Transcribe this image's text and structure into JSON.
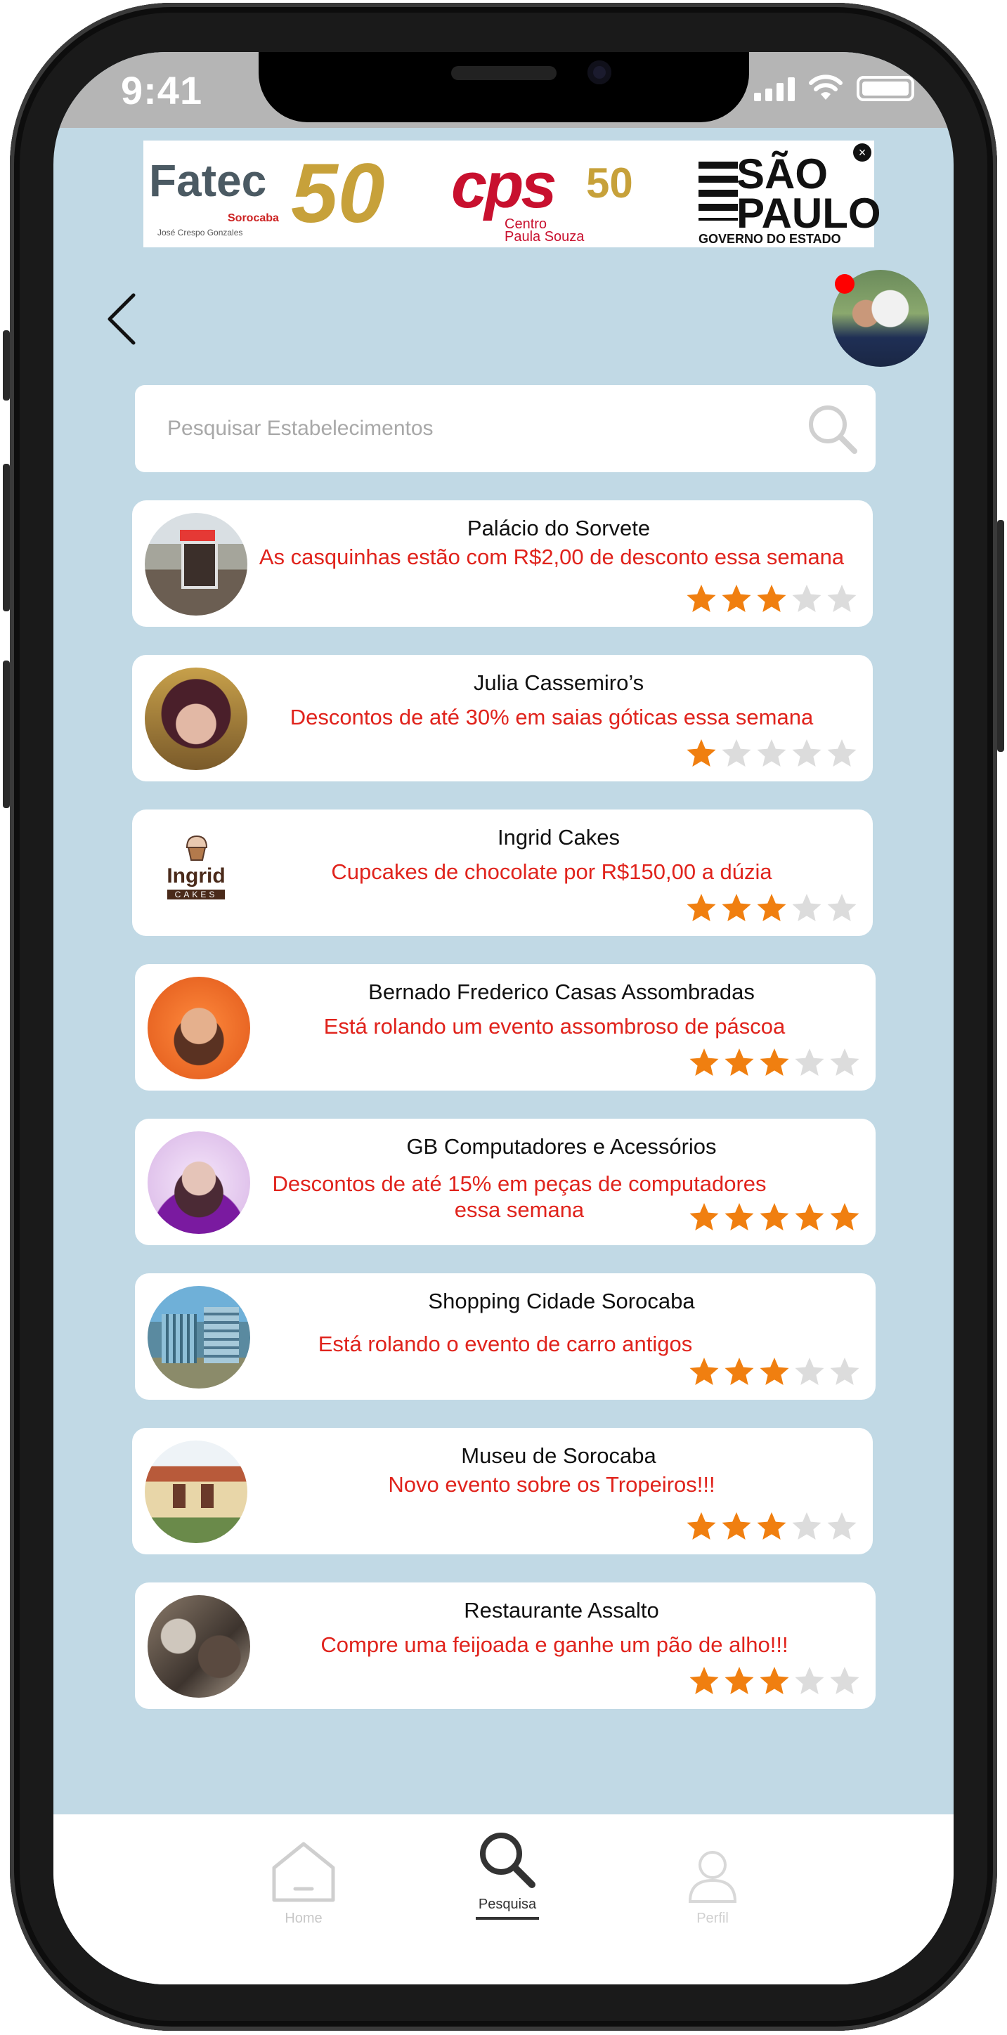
{
  "status_bar": {
    "time": "9:41"
  },
  "banner": {
    "fatec_text": "Fatec",
    "fatec_sub": "Sorocaba",
    "fatec_sub2": "José Crespo Gonzales",
    "fatec_50": "50",
    "cps_text": "cps",
    "cps_50": "50",
    "cps_sub": "Centro\nPaula Souza",
    "sp_text": "SÃO\nPAULO",
    "sp_sub": "GOVERNO DO ESTADO",
    "close": "×"
  },
  "search": {
    "placeholder": "Pesquisar Estabelecimentos"
  },
  "establishments": [
    {
      "name": "Palácio do Sorvete",
      "promo": "As casquinhas estão com R$2,00 de desconto essa semana",
      "rating": 3
    },
    {
      "name": "Julia Cassemiro’s",
      "promo": "Descontos de até 30% em saias góticas essa semana",
      "rating": 1
    },
    {
      "name": "Ingrid Cakes",
      "promo": "Cupcakes de chocolate por R$150,00 a dúzia",
      "rating": 3,
      "logo_text": "Ingrid",
      "logo_sub": "CAKES"
    },
    {
      "name": "Bernado Frederico Casas Assombradas",
      "promo": "Está rolando um evento assombroso de páscoa",
      "rating": 3
    },
    {
      "name": "GB Computadores e Acessórios",
      "promo": "Descontos de até 15% em peças de computadores essa semana",
      "rating": 5
    },
    {
      "name": "Shopping Cidade Sorocaba",
      "promo": "Está rolando o evento de carro antigos",
      "rating": 3
    },
    {
      "name": "Museu de Sorocaba",
      "promo": "Novo evento sobre os Tropeiros!!!",
      "rating": 3
    },
    {
      "name": "Restaurante Assalto",
      "promo": "Compre uma feijoada e ganhe um pão de alho!!!",
      "rating": 3
    }
  ],
  "nav": {
    "home": "Home",
    "search": "Pesquisa",
    "profile": "Perfil"
  },
  "colors": {
    "background": "#c1d9e5",
    "promo_text": "#e0231c",
    "star_filled": "#f07f10",
    "star_empty": "#dcdcdc"
  }
}
